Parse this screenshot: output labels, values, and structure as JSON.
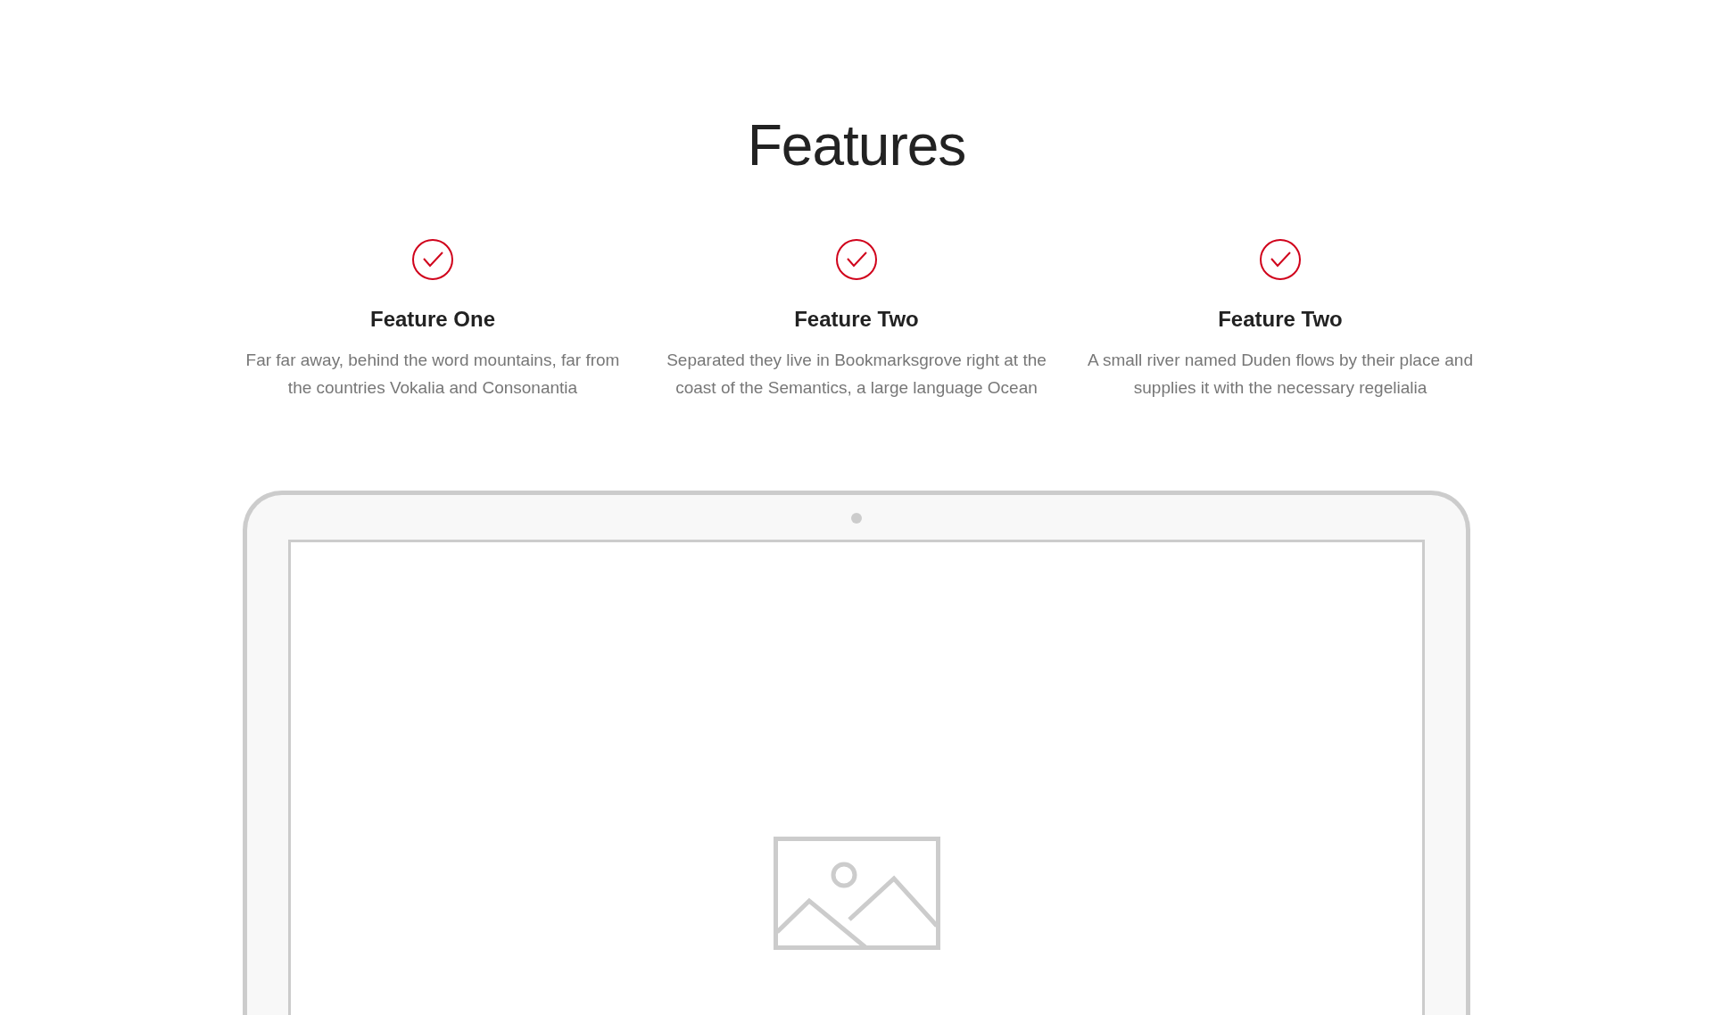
{
  "heading": "Features",
  "features": [
    {
      "title": "Feature One",
      "text": "Far far away, behind the word mountains, far from the countries Vokalia and Consonantia"
    },
    {
      "title": "Feature Two",
      "text": "Separated they live in Bookmarksgrove right at the coast of the Semantics, a large language Ocean"
    },
    {
      "title": "Feature Two",
      "text": "A small river named Duden flows by their place and supplies it with the necessary regelialia"
    }
  ]
}
